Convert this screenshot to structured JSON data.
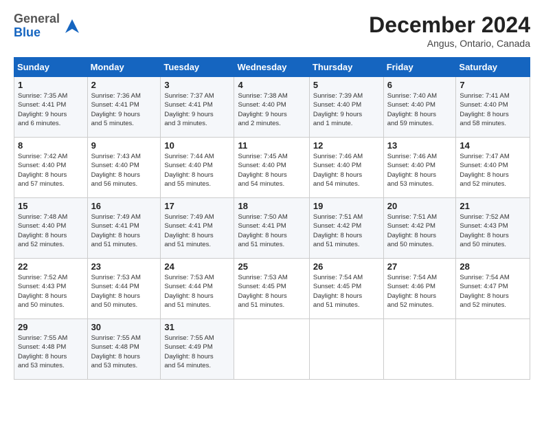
{
  "logo": {
    "general": "General",
    "blue": "Blue"
  },
  "header": {
    "month": "December 2024",
    "location": "Angus, Ontario, Canada"
  },
  "days_of_week": [
    "Sunday",
    "Monday",
    "Tuesday",
    "Wednesday",
    "Thursday",
    "Friday",
    "Saturday"
  ],
  "weeks": [
    [
      {
        "day": "1",
        "info": "Sunrise: 7:35 AM\nSunset: 4:41 PM\nDaylight: 9 hours\nand 6 minutes."
      },
      {
        "day": "2",
        "info": "Sunrise: 7:36 AM\nSunset: 4:41 PM\nDaylight: 9 hours\nand 5 minutes."
      },
      {
        "day": "3",
        "info": "Sunrise: 7:37 AM\nSunset: 4:41 PM\nDaylight: 9 hours\nand 3 minutes."
      },
      {
        "day": "4",
        "info": "Sunrise: 7:38 AM\nSunset: 4:40 PM\nDaylight: 9 hours\nand 2 minutes."
      },
      {
        "day": "5",
        "info": "Sunrise: 7:39 AM\nSunset: 4:40 PM\nDaylight: 9 hours\nand 1 minute."
      },
      {
        "day": "6",
        "info": "Sunrise: 7:40 AM\nSunset: 4:40 PM\nDaylight: 8 hours\nand 59 minutes."
      },
      {
        "day": "7",
        "info": "Sunrise: 7:41 AM\nSunset: 4:40 PM\nDaylight: 8 hours\nand 58 minutes."
      }
    ],
    [
      {
        "day": "8",
        "info": "Sunrise: 7:42 AM\nSunset: 4:40 PM\nDaylight: 8 hours\nand 57 minutes."
      },
      {
        "day": "9",
        "info": "Sunrise: 7:43 AM\nSunset: 4:40 PM\nDaylight: 8 hours\nand 56 minutes."
      },
      {
        "day": "10",
        "info": "Sunrise: 7:44 AM\nSunset: 4:40 PM\nDaylight: 8 hours\nand 55 minutes."
      },
      {
        "day": "11",
        "info": "Sunrise: 7:45 AM\nSunset: 4:40 PM\nDaylight: 8 hours\nand 54 minutes."
      },
      {
        "day": "12",
        "info": "Sunrise: 7:46 AM\nSunset: 4:40 PM\nDaylight: 8 hours\nand 54 minutes."
      },
      {
        "day": "13",
        "info": "Sunrise: 7:46 AM\nSunset: 4:40 PM\nDaylight: 8 hours\nand 53 minutes."
      },
      {
        "day": "14",
        "info": "Sunrise: 7:47 AM\nSunset: 4:40 PM\nDaylight: 8 hours\nand 52 minutes."
      }
    ],
    [
      {
        "day": "15",
        "info": "Sunrise: 7:48 AM\nSunset: 4:40 PM\nDaylight: 8 hours\nand 52 minutes."
      },
      {
        "day": "16",
        "info": "Sunrise: 7:49 AM\nSunset: 4:41 PM\nDaylight: 8 hours\nand 51 minutes."
      },
      {
        "day": "17",
        "info": "Sunrise: 7:49 AM\nSunset: 4:41 PM\nDaylight: 8 hours\nand 51 minutes."
      },
      {
        "day": "18",
        "info": "Sunrise: 7:50 AM\nSunset: 4:41 PM\nDaylight: 8 hours\nand 51 minutes."
      },
      {
        "day": "19",
        "info": "Sunrise: 7:51 AM\nSunset: 4:42 PM\nDaylight: 8 hours\nand 51 minutes."
      },
      {
        "day": "20",
        "info": "Sunrise: 7:51 AM\nSunset: 4:42 PM\nDaylight: 8 hours\nand 50 minutes."
      },
      {
        "day": "21",
        "info": "Sunrise: 7:52 AM\nSunset: 4:43 PM\nDaylight: 8 hours\nand 50 minutes."
      }
    ],
    [
      {
        "day": "22",
        "info": "Sunrise: 7:52 AM\nSunset: 4:43 PM\nDaylight: 8 hours\nand 50 minutes."
      },
      {
        "day": "23",
        "info": "Sunrise: 7:53 AM\nSunset: 4:44 PM\nDaylight: 8 hours\nand 50 minutes."
      },
      {
        "day": "24",
        "info": "Sunrise: 7:53 AM\nSunset: 4:44 PM\nDaylight: 8 hours\nand 51 minutes."
      },
      {
        "day": "25",
        "info": "Sunrise: 7:53 AM\nSunset: 4:45 PM\nDaylight: 8 hours\nand 51 minutes."
      },
      {
        "day": "26",
        "info": "Sunrise: 7:54 AM\nSunset: 4:45 PM\nDaylight: 8 hours\nand 51 minutes."
      },
      {
        "day": "27",
        "info": "Sunrise: 7:54 AM\nSunset: 4:46 PM\nDaylight: 8 hours\nand 52 minutes."
      },
      {
        "day": "28",
        "info": "Sunrise: 7:54 AM\nSunset: 4:47 PM\nDaylight: 8 hours\nand 52 minutes."
      }
    ],
    [
      {
        "day": "29",
        "info": "Sunrise: 7:55 AM\nSunset: 4:48 PM\nDaylight: 8 hours\nand 53 minutes."
      },
      {
        "day": "30",
        "info": "Sunrise: 7:55 AM\nSunset: 4:48 PM\nDaylight: 8 hours\nand 53 minutes."
      },
      {
        "day": "31",
        "info": "Sunrise: 7:55 AM\nSunset: 4:49 PM\nDaylight: 8 hours\nand 54 minutes."
      },
      {
        "day": "",
        "info": ""
      },
      {
        "day": "",
        "info": ""
      },
      {
        "day": "",
        "info": ""
      },
      {
        "day": "",
        "info": ""
      }
    ]
  ]
}
